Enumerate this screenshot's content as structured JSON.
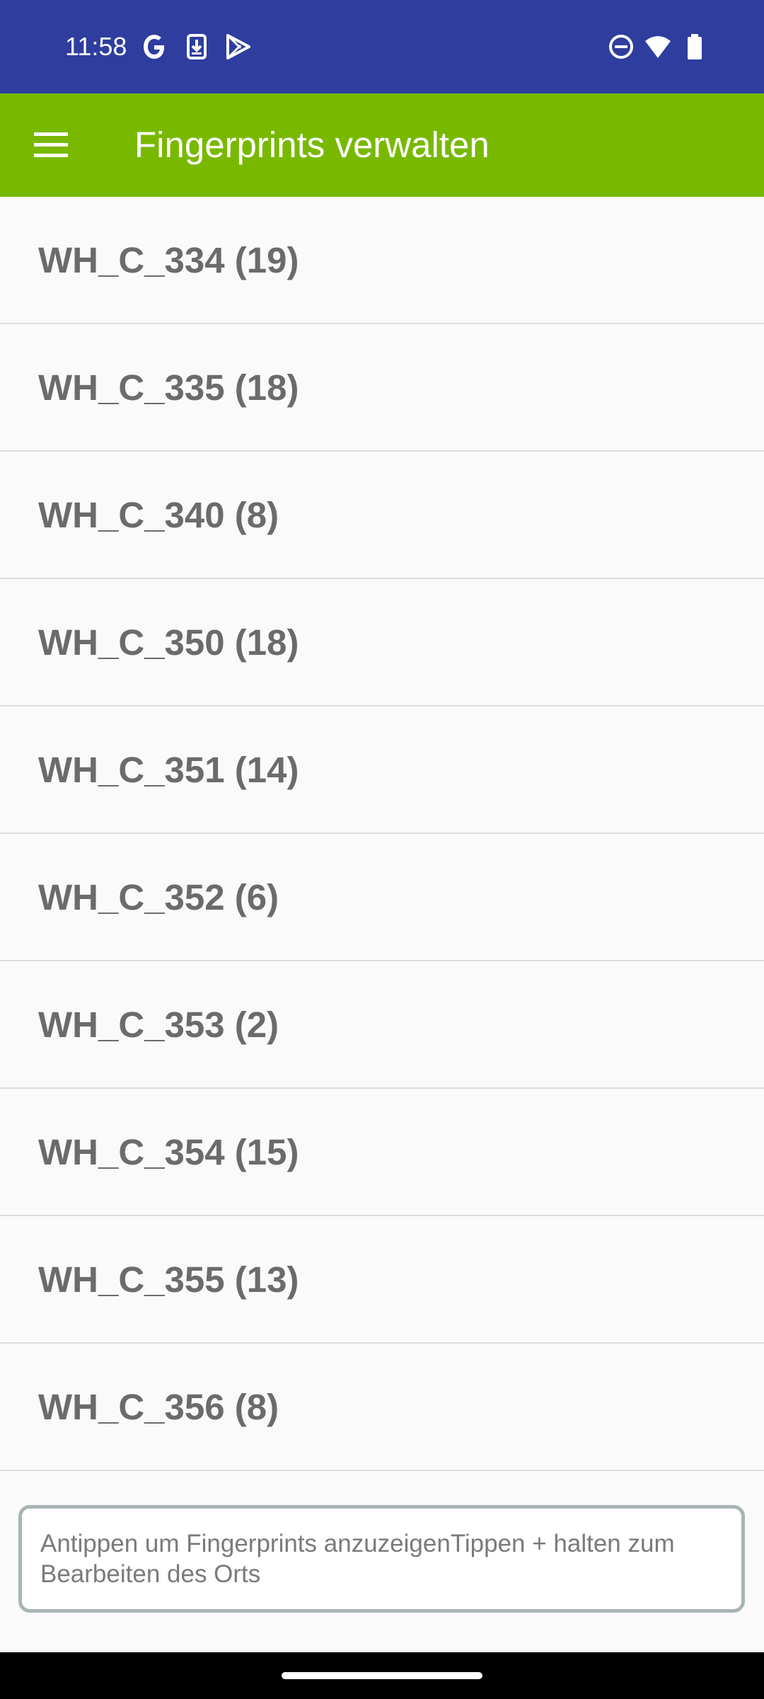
{
  "status_bar": {
    "time": "11:58",
    "left_icons": [
      "google-icon",
      "download-icon",
      "play-store-icon"
    ],
    "right_icons": [
      "do-not-disturb-icon",
      "wifi-icon",
      "battery-icon"
    ],
    "background": "#2e3d9e"
  },
  "app_bar": {
    "title": "Fingerprints verwalten",
    "menu_icon": "hamburger-menu-icon",
    "background": "#78b900"
  },
  "list": {
    "items": [
      {
        "label": "WH_C_334 (19)"
      },
      {
        "label": "WH_C_335 (18)"
      },
      {
        "label": "WH_C_340 (8)"
      },
      {
        "label": "WH_C_350 (18)"
      },
      {
        "label": "WH_C_351 (14)"
      },
      {
        "label": "WH_C_352 (6)"
      },
      {
        "label": "WH_C_353 (2)"
      },
      {
        "label": "WH_C_354 (15)"
      },
      {
        "label": "WH_C_355 (13)"
      },
      {
        "label": "WH_C_356 (8)"
      }
    ]
  },
  "hint": {
    "text": "Antippen um Fingerprints anzuzeigenTippen + halten zum Bearbeiten des Orts"
  },
  "colors": {
    "text_list": "#6b6b6b",
    "divider": "#dcdcdc",
    "hint_border": "#a9b4b5"
  }
}
